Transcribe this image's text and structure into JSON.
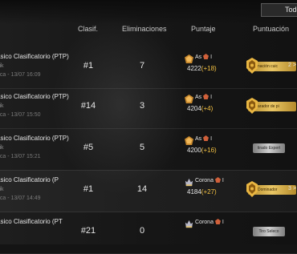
{
  "filter_label": "Todo",
  "columns": {
    "rank": "Clasif.",
    "kills": "Eliminaciones",
    "score": "Puntaje",
    "rating": "Puntuación"
  },
  "rows": [
    {
      "mode": "ásico Clasificatorio (PTP)",
      "map": "vik",
      "date": "rica - 13/07 16:09",
      "rank": "#1",
      "kills": "7",
      "tier": "As",
      "tier_level": "I",
      "score": "4222",
      "gain": "(+18)",
      "title": "nación cuic",
      "title_style": "gold",
      "title_count": "2 >",
      "selected": false
    },
    {
      "mode": "ásico Clasificatorio (PTP)",
      "map": "vik",
      "date": "rica - 13/07 15:50",
      "rank": "#14",
      "kills": "3",
      "tier": "As",
      "tier_level": "I",
      "score": "4204",
      "gain": "(+4)",
      "title": "arador de pi",
      "title_style": "gold",
      "title_count": "",
      "selected": false
    },
    {
      "mode": "ásico Clasificatorio (PTP)",
      "map": "vik",
      "date": "rica - 13/07 15:21",
      "rank": "#5",
      "kills": "5",
      "tier": "As",
      "tier_level": "I",
      "score": "4200",
      "gain": "(+16)",
      "title": "tirado Expert",
      "title_style": "silver",
      "title_count": "",
      "selected": false
    },
    {
      "mode": "ásico Clasificatorio (P",
      "map": "vik",
      "date": "rica - 13/07 14:49",
      "rank": "#1",
      "kills": "14",
      "tier": "Corona",
      "tier_level": "I",
      "score": "4184",
      "gain": "(+27)",
      "title": "Dominador",
      "title_style": "gold",
      "title_count": "3 >",
      "selected": true
    },
    {
      "mode": "ásico Clasificatorio (PT",
      "map": "",
      "date": "",
      "rank": "#21",
      "kills": "0",
      "tier": "Corona",
      "tier_level": "I",
      "score": "",
      "gain": "",
      "title": "Tiro Seleco",
      "title_style": "silver",
      "title_count": "",
      "selected": false
    }
  ]
}
